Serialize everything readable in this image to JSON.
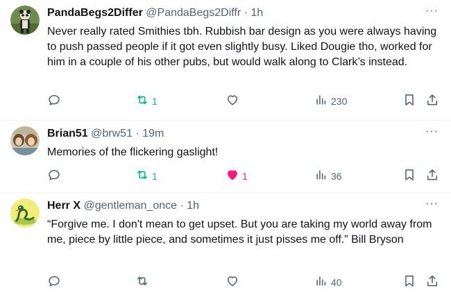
{
  "tweets": [
    {
      "name": "PandaBegs2Differ",
      "handle": "@PandaBegs2Diffr",
      "separator": "·",
      "time": "1h",
      "text": "Never really rated Smithies tbh. Rubbish bar design as you were always having to push passed people if it got even slightly busy. Liked Dougie tho, worked for him in a couple of his other pubs, but would walk along to Clark’s instead.",
      "replies": "",
      "retweets": "1",
      "likes": "",
      "views": "230",
      "retweeted": true,
      "liked": false
    },
    {
      "name": "Brian51",
      "handle": "@brw51",
      "separator": "·",
      "time": "19m",
      "text": "Memories of the flickering gaslight!",
      "replies": "",
      "retweets": "1",
      "likes": "1",
      "views": "36",
      "retweeted": true,
      "liked": true
    },
    {
      "name": "Herr X",
      "handle": "@gentleman_once",
      "separator": "·",
      "time": "1h",
      "text": "“Forgive me. I don't mean to get upset. But you are taking my world away from me, piece by little piece, and sometimes it just pisses me off.” Bill Bryson",
      "replies": "",
      "retweets": "",
      "likes": "",
      "views": "40",
      "retweeted": false,
      "liked": false
    }
  ],
  "more_icon": "···",
  "icons": [
    "reply-icon",
    "retweet-icon",
    "like-icon",
    "views-icon",
    "bookmark-icon",
    "share-icon",
    "more-icon"
  ],
  "colors": {
    "retweet_active": "#00ba7c",
    "like_active": "#f91880",
    "icon_default": "#536471",
    "text": "#0f1419",
    "secondary": "#536471"
  }
}
